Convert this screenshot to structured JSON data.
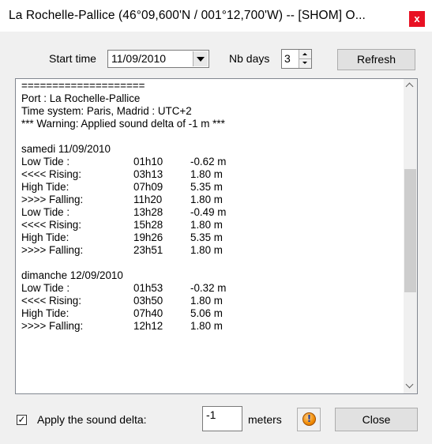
{
  "window": {
    "title": "La Rochelle-Pallice (46°09,600'N / 001°12,700'W) -- [SHOM] O...",
    "close_glyph": "x"
  },
  "controls": {
    "start_time_label": "Start time",
    "start_time_value": "11/09/2010",
    "nb_days_label": "Nb days",
    "nb_days_value": "3",
    "refresh_label": "Refresh"
  },
  "report": {
    "header": [
      "====================",
      "Port : La Rochelle-Pallice",
      "Time system: Paris, Madrid : UTC+2",
      "*** Warning: Applied sound delta of -1 m ***"
    ],
    "days": [
      {
        "title": "samedi 11/09/2010",
        "rows": [
          {
            "event": "Low Tide :",
            "time": "01h10",
            "height": "-0.62 m"
          },
          {
            "event": "<<<< Rising:",
            "time": "03h13",
            "height": "1.80 m"
          },
          {
            "event": "High Tide:",
            "time": "07h09",
            "height": "5.35 m"
          },
          {
            "event": ">>>> Falling:",
            "time": "11h20",
            "height": "1.80 m"
          },
          {
            "event": "Low Tide :",
            "time": "13h28",
            "height": "-0.49 m"
          },
          {
            "event": "<<<< Rising:",
            "time": "15h28",
            "height": "1.80 m"
          },
          {
            "event": "High Tide:",
            "time": "19h26",
            "height": "5.35 m"
          },
          {
            "event": ">>>> Falling:",
            "time": "23h51",
            "height": "1.80 m"
          }
        ]
      },
      {
        "title": "dimanche 12/09/2010",
        "rows": [
          {
            "event": "Low Tide :",
            "time": "01h53",
            "height": "-0.32 m"
          },
          {
            "event": "<<<< Rising:",
            "time": "03h50",
            "height": "1.80 m"
          },
          {
            "event": "High Tide:",
            "time": "07h40",
            "height": "5.06 m"
          },
          {
            "event": ">>>> Falling:",
            "time": "12h12",
            "height": "1.80 m"
          }
        ]
      }
    ],
    "scroll_position": 0.3
  },
  "footer": {
    "apply_delta_label": "Apply the sound delta:",
    "apply_delta_checked": true,
    "check_glyph": "✓",
    "delta_value": "-1",
    "delta_unit": "meters",
    "warning_glyph": "!",
    "close_label": "Close"
  }
}
